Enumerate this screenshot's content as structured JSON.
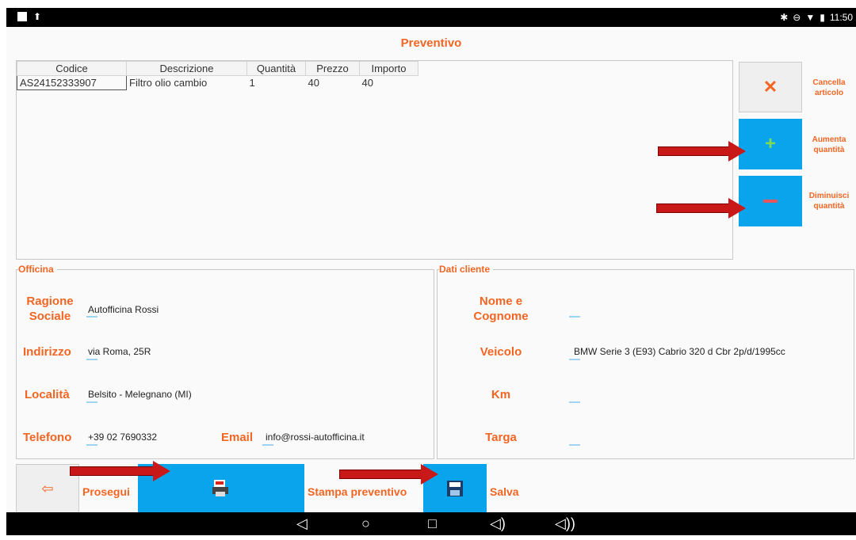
{
  "status_bar": {
    "time": "11:50"
  },
  "header": {
    "title": "Preventivo"
  },
  "table": {
    "columns": [
      "Codice",
      "Descrizione",
      "Quantità",
      "Prezzo",
      "Importo"
    ],
    "rows": [
      {
        "codice": "AS24152333907",
        "descrizione": "Filtro olio cambio",
        "quantita": "1",
        "prezzo": "40",
        "importo": "40"
      }
    ]
  },
  "side_actions": {
    "cancel": {
      "label_line1": "Cancella",
      "label_line2": "articolo",
      "icon": "close-icon"
    },
    "increase": {
      "label_line1": "Aumenta",
      "label_line2": "quantità",
      "icon": "plus-icon"
    },
    "decrease": {
      "label_line1": "Diminuisci",
      "label_line2": "quantità",
      "icon": "minus-icon"
    }
  },
  "officina": {
    "section_title": "Officina",
    "ragione_label_line1": "Ragione",
    "ragione_label_line2": "Sociale",
    "ragione_value": "Autofficina Rossi",
    "indirizzo_label": "Indirizzo",
    "indirizzo_value": "via Roma, 25R",
    "localita_label": "Località",
    "localita_value": "Belsito - Melegnano (MI)",
    "telefono_label": "Telefono",
    "telefono_value": "+39 02 7690332",
    "email_label": "Email",
    "email_value": "info@rossi-autofficina.it"
  },
  "cliente": {
    "section_title": "Dati cliente",
    "nome_label_line1": "Nome e",
    "nome_label_line2": "Cognome",
    "nome_value": "",
    "veicolo_label": "Veicolo",
    "veicolo_value": "BMW Serie 3 (E93) Cabrio 320 d Cbr 2p/d/1995cc",
    "km_label": "Km",
    "km_value": "",
    "targa_label": "Targa",
    "targa_value": ""
  },
  "bottom_actions": {
    "prosegui": "Prosegui",
    "stampa": "Stampa preventivo",
    "salva": "Salva"
  },
  "colors": {
    "accent": "#f26522",
    "button_blue": "#0aa4ed",
    "arrow_red": "#c81818"
  }
}
